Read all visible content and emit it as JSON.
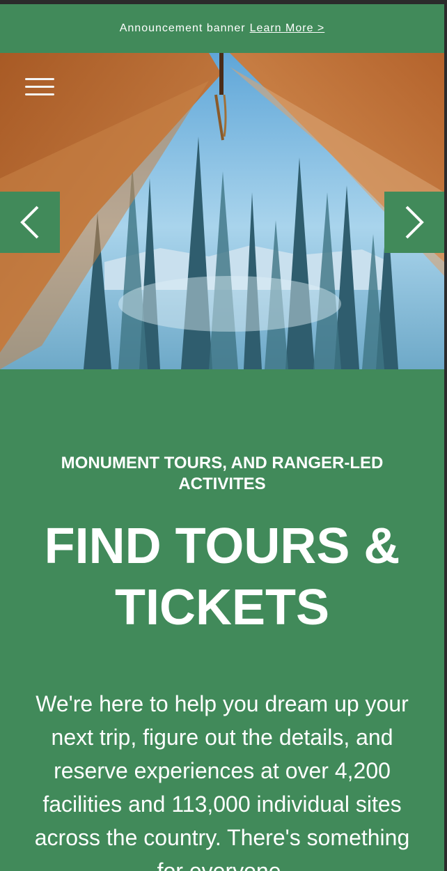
{
  "announcement": {
    "text": "Announcement banner",
    "link_label": "Learn More >"
  },
  "hero": {
    "image_description_icon": "tent-forest-image",
    "menu_icon": "hamburger-menu-icon",
    "prev_icon": "chevron-left-icon",
    "next_icon": "chevron-right-icon"
  },
  "content": {
    "eyebrow": "MONUMENT TOURS, AND RANGER-LED ACTIVITES",
    "headline": "FIND TOURS & TICKETS",
    "body": "We're here to help you dream up your next trip, figure out the details, and reserve experiences at over 4,200 facilities and 113,000 individual sites across the country. There's something for everyone."
  },
  "colors": {
    "brand_green": "#418a5a",
    "text": "#ffffff",
    "tent_canvas": "#b8672e",
    "sky": "#89c2e3"
  }
}
